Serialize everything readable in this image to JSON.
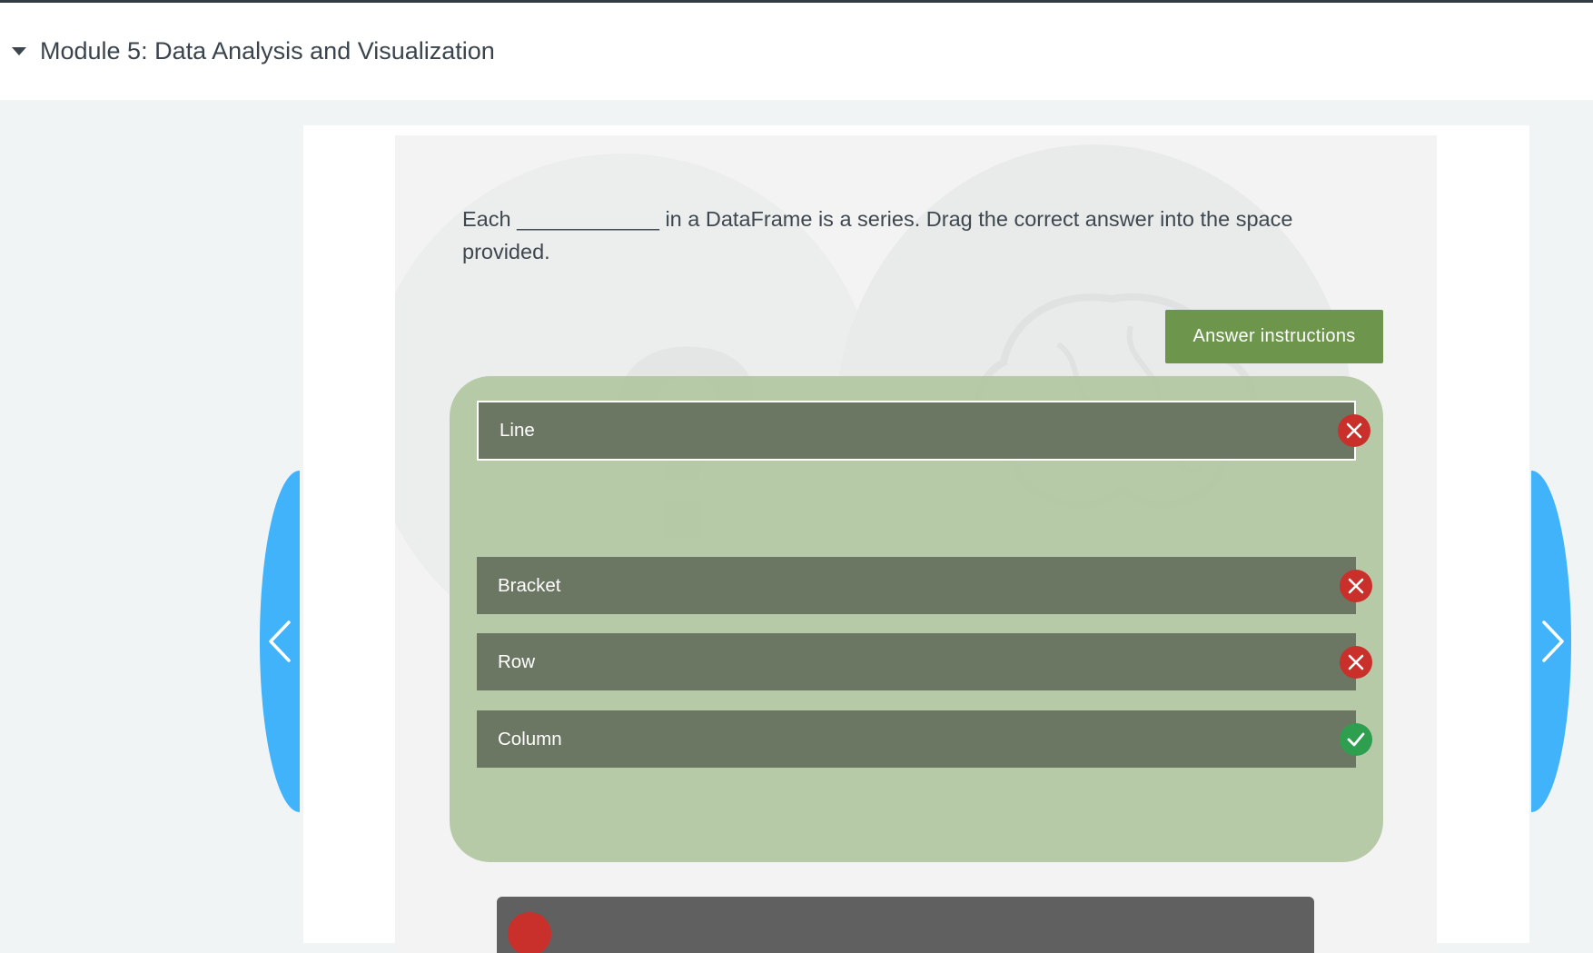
{
  "module": {
    "title": "Module 5: Data Analysis and Visualization"
  },
  "question": {
    "text": "Each ____________ in a DataFrame is a series. Drag the correct answer into the space provided."
  },
  "answer_button": {
    "label": "Answer instructions"
  },
  "options": [
    {
      "label": "Line",
      "status": "incorrect",
      "placed": true
    },
    {
      "label": "Bracket",
      "status": "incorrect",
      "placed": false
    },
    {
      "label": "Row",
      "status": "incorrect",
      "placed": false
    },
    {
      "label": "Column",
      "status": "correct",
      "placed": false
    }
  ],
  "colors": {
    "accent_blue": "#40b3fa",
    "button_green": "#6d954c",
    "panel_green": "#b1c7a2",
    "option_dark": "#6b7762",
    "incorrect_red": "#c9302c",
    "correct_green": "#2e9e4f"
  },
  "icons": {
    "collapse": "caret-down-icon",
    "prev": "chevron-left-icon",
    "next": "chevron-right-icon",
    "incorrect": "x-circle-icon",
    "correct": "check-circle-icon"
  }
}
